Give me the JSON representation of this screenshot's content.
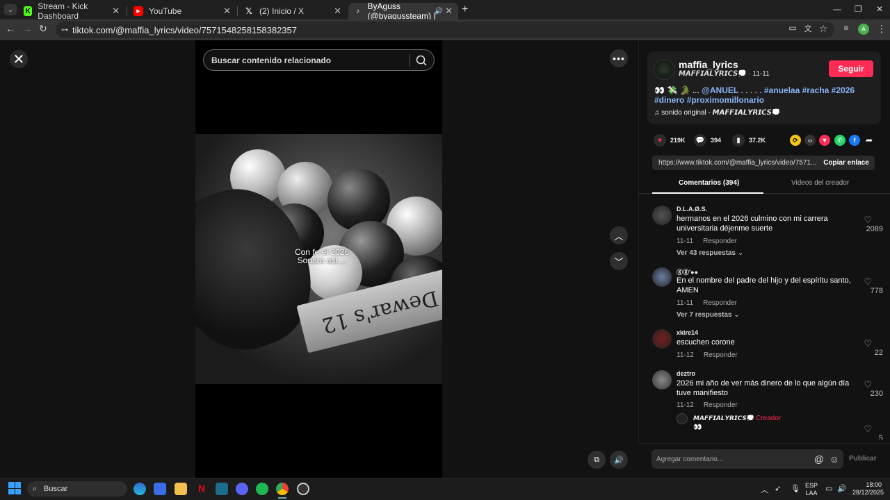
{
  "browser": {
    "tabs": [
      {
        "label": "Stream - Kick Dashboard",
        "icon": "kick-icon"
      },
      {
        "label": "YouTube",
        "icon": "youtube-icon"
      },
      {
        "label": "(2) Inicio / X",
        "icon": "x-icon"
      },
      {
        "label": "ByAguss (@byagussteam) |",
        "icon": "tiktok-icon",
        "active": true
      }
    ],
    "url": "tiktok.com/@maffia_lyrics/video/7571548258158382357",
    "profile_initial": "A"
  },
  "viewer": {
    "search_placeholder": "Buscar contenido relacionado",
    "caption_line1": "Con fe el 2026",
    "caption_line2": "Sonara asi....",
    "video_text": "Dewar's 12"
  },
  "post": {
    "username": "maffia_lyrics",
    "subline": "𝙈𝘼𝙁𝙁𝙄𝘼𝙇𝙔𝙍𝙄𝘾𝙎💭 · 11-11",
    "follow_label": "Seguir",
    "desc_prefix": "👀 💸 🐊 ... ",
    "desc_mention": "@ANUEL",
    "desc_mid": " . . . . . ",
    "hashtags": [
      "#anuelaa",
      "#racha",
      "#2026",
      "#dinero",
      "#proximomillonario"
    ],
    "sound": "♫  sonido original - 𝙈𝘼𝙁𝙁𝙄𝘼𝙇𝙔𝙍𝙄𝘾𝙎💭",
    "likes": "219K",
    "comments": "394",
    "saves": "37.2K",
    "link": "https://www.tiktok.com/@maffia_lyrics/video/7571...",
    "copy_label": "Copiar enlace"
  },
  "panel_tabs": {
    "comments": "Comentarios (394)",
    "creator_videos": "Videos del creador"
  },
  "comments": [
    {
      "name": "D.L.A.Ø.S.",
      "text": "hermanos en el 2026 culmino con mi carrera universitaria déjenme suerte",
      "date": "11-11",
      "reply": "Responder",
      "likes": "2089",
      "replies": "Ver 43 respuestas ⌄"
    },
    {
      "name": "ⓍⓍ'●●",
      "text": "En el nombre del padre del hijo y del espíritu santo, AMEN",
      "date": "11-11",
      "reply": "Responder",
      "likes": "778",
      "replies": "Ver 7 respuestas ⌄"
    },
    {
      "name": "xkire14",
      "text": "escuchen corone",
      "date": "11-12",
      "reply": "Responder",
      "likes": "22",
      "replies": ""
    },
    {
      "name": "deztro",
      "text": "2026 mi año de ver más dinero de lo que algún día tuve manifiesto",
      "date": "11-12",
      "reply": "Responder",
      "likes": "230",
      "replies": ""
    }
  ],
  "creator_reply": {
    "name": "𝙈𝘼𝙁𝙁𝙄𝘼𝙇𝙔𝙍𝙄𝘾𝙎💭",
    "badge": "· Creador",
    "text": "👀",
    "likes": "5"
  },
  "comment_input": {
    "placeholder": "Agregar comentario...",
    "publish": "Publicar"
  },
  "taskbar": {
    "search": "Buscar",
    "lang1": "ESP",
    "lang2": "LAA",
    "time": "18:00",
    "date": "28/12/2025"
  },
  "colors": {
    "accent": "#fe2c55",
    "hashtag": "#8ab4f8",
    "panel": "#121212"
  }
}
